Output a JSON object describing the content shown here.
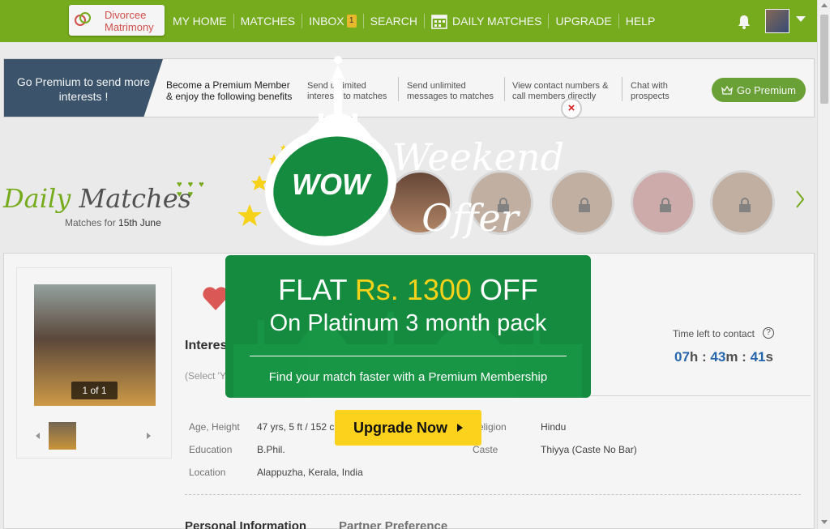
{
  "brand": {
    "line1": "Divorcee",
    "line2": "Matrimony"
  },
  "nav": {
    "home": "MY HOME",
    "matches": "MATCHES",
    "inbox": "INBOX",
    "inbox_count": "1",
    "search": "SEARCH",
    "daily_matches": "DAILY MATCHES",
    "upgrade": "UPGRADE",
    "help": "HELP"
  },
  "premium_banner": {
    "left_text": "Go Premium to send more interests !",
    "intro_line1": "Become a Premium Member",
    "intro_line2": "& enjoy the following benefits",
    "benefit1_line1": "Send unlimited",
    "benefit1_line2": "interests to matches",
    "benefit2_line1": "Send unlimited",
    "benefit2_line2": "messages to matches",
    "benefit3_line1": "View contact numbers &",
    "benefit3_line2": "call members directly",
    "benefit4_line1": "Chat with",
    "benefit4_line2": "prospects",
    "button": "Go Premium"
  },
  "daily_matches": {
    "title_word1": "Daily",
    "title_word2": "Matches",
    "subtitle_prefix": "Matches for",
    "date": "15th June"
  },
  "profile": {
    "photo_count": "1 of 1",
    "interest_heading": "Interes",
    "select_hint": "(Select 'Y",
    "timer_label": "Time left to contact",
    "timer_h": "07",
    "timer_m": "43",
    "timer_s": "41",
    "details": {
      "age_label": "Age, Height",
      "age_value": "47 yrs, 5 ft / 152 c",
      "education_label": "Education",
      "education_value": "B.Phil.",
      "location_label": "Location",
      "location_value": "Alappuzha, Kerala, India",
      "religion_label": "eligion",
      "religion_value": "Hindu",
      "caste_label": "Caste",
      "caste_value": "Thiyya (Caste No Bar)"
    },
    "tabs": [
      "Personal Information",
      "Partner Preference"
    ]
  },
  "offer": {
    "badge": "WOW",
    "weekend": "Weekend",
    "offer_word": "Offer",
    "line1_a": "FLAT ",
    "line1_price": "Rs. 1300",
    "line1_b": " OFF",
    "line2": "On Platinum 3 month pack",
    "line3": "Find your match faster with a Premium Membership",
    "button": "Upgrade Now",
    "close": "×"
  },
  "colors": {
    "nav_green": "#7ab21e",
    "offer_green": "#148b3e",
    "gold": "#f7d21b",
    "banner_blue": "#3e5871",
    "timer_blue": "#2a6bb4"
  }
}
